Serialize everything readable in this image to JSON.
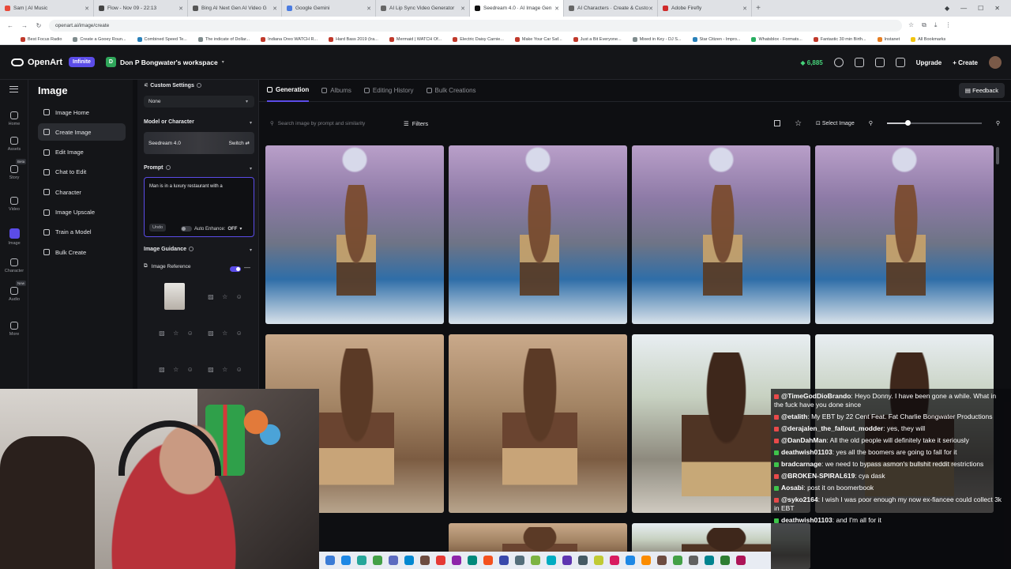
{
  "browser": {
    "tabs": [
      {
        "label": "Sam | AI Music",
        "color": "#e84a3a"
      },
      {
        "label": "Flow - Nov 09 - 22:13",
        "color": "#444444"
      },
      {
        "label": "Bing AI Next Gen AI Video G",
        "color": "#555555"
      },
      {
        "label": "Google Gemini",
        "color": "#4a7be0"
      },
      {
        "label": "AI Lip Sync Video Generator",
        "color": "#666666"
      },
      {
        "label": "Seedream 4.0 · AI Image Gen",
        "color": "#111111"
      },
      {
        "label": "AI Characters · Create & Custo",
        "color": "#666666"
      },
      {
        "label": "Adobe Firefly",
        "color": "#d02a2a"
      }
    ],
    "url": "openart.ai/image/create",
    "bookmarks": [
      {
        "label": "Best Focus Radio",
        "color": "#c0392b"
      },
      {
        "label": "Create a Gooey Roun...",
        "color": "#7f8c8d"
      },
      {
        "label": "Combined Speed Te...",
        "color": "#2980b9"
      },
      {
        "label": "The indicate of Dollar...",
        "color": "#7f8c8d"
      },
      {
        "label": "Indiana Oreo WATCH R...",
        "color": "#c0392b"
      },
      {
        "label": "Hard Bass 2019 (Ira...",
        "color": "#c0392b"
      },
      {
        "label": "Mermaid | WATCH Of...",
        "color": "#c0392b"
      },
      {
        "label": "Electric Daisy Carnie...",
        "color": "#c0392b"
      },
      {
        "label": "Make Your Car Saf...",
        "color": "#c0392b"
      },
      {
        "label": "Just a Bit Everyone...",
        "color": "#c0392b"
      },
      {
        "label": "Mixed in Key - DJ S...",
        "color": "#7f8c8d"
      },
      {
        "label": "Star Citizen - Impro...",
        "color": "#2980b9"
      },
      {
        "label": "Whatsblox - Formats...",
        "color": "#27ae60"
      },
      {
        "label": "Fantastic 30 min Birth...",
        "color": "#c0392b"
      },
      {
        "label": "Instanet",
        "color": "#e67e22"
      },
      {
        "label": "All Bookmarks",
        "color": "#f1c40f"
      }
    ]
  },
  "header": {
    "brand": "OpenArt",
    "plan_badge": "Infinite",
    "workspace_initial": "D",
    "workspace": "Don P Bongwater's workspace",
    "credits": "6,885",
    "upgrade": "Upgrade",
    "create": "Create"
  },
  "rail": [
    {
      "label": "Home"
    },
    {
      "label": "Assets"
    },
    {
      "label": "Story",
      "badge": "Beta"
    },
    {
      "label": "Video"
    },
    {
      "label": "Image"
    },
    {
      "label": "Character"
    },
    {
      "label": "Audio",
      "badge": "New"
    },
    {
      "label": "More"
    }
  ],
  "sidemenu": {
    "title": "Image",
    "items": [
      {
        "label": "Image Home"
      },
      {
        "label": "Create Image"
      },
      {
        "label": "Edit Image"
      },
      {
        "label": "Chat to Edit"
      },
      {
        "label": "Character"
      },
      {
        "label": "Image Upscale"
      },
      {
        "label": "Train a Model"
      },
      {
        "label": "Bulk Create"
      }
    ]
  },
  "settings": {
    "custom_label": "Custom Settings",
    "custom_value": "None",
    "model_label": "Model or Character",
    "model_name": "Seedream 4.0",
    "switch": "Switch",
    "prompt_label": "Prompt",
    "prompt_text": "Man is in a luxury restaurant with a",
    "undo": "Undo",
    "auto_enhance": "Auto Enhance:",
    "auto_enhance_state": "OFF",
    "guidance_label": "Image Guidance",
    "image_reference": "Image Reference"
  },
  "main": {
    "tabs": [
      {
        "label": "Generation"
      },
      {
        "label": "Albums"
      },
      {
        "label": "Editing History"
      },
      {
        "label": "Bulk Creations"
      }
    ],
    "feedback": "Feedback",
    "search_placeholder": "Search image by prompt and similarity",
    "filters": "Filters",
    "select_image": "Select Image",
    "zoom_level": 0.22
  },
  "chat": [
    {
      "user": "@TimeGodDioBrando",
      "text": "Heyo Donny. I have been gone a while. What in the fuck have you done since",
      "color": "#e84a4a"
    },
    {
      "user": "@etalith",
      "text": "My EBT by 22 Cent Feat. Fat Charlie Bongwater Productions",
      "color": "#e84a4a"
    },
    {
      "user": "@derajalen_the_fallout_modder",
      "text": "yes, they will",
      "color": "#e84a4a"
    },
    {
      "user": "@DanDahMan",
      "text": "All the old people will definitely take it seriously",
      "color": "#e84a4a"
    },
    {
      "user": "deathwish01103",
      "text": "yes all the boomers are going to fall for it",
      "color": "#3ec44b"
    },
    {
      "user": "bradcarnage",
      "text": "we need to bypass asmon's bullshit reddit restrictions",
      "color": "#3ec44b"
    },
    {
      "user": "@BROKEN-SPIRAL619",
      "text": "cya dask",
      "color": "#e84a4a"
    },
    {
      "user": "Aosabi",
      "text": "post it on boomerbook",
      "color": "#3ec44b"
    },
    {
      "user": "@syko2164",
      "text": "I wish I was poor enough my now ex-fiancee could collect 3k in EBT",
      "color": "#e84a4a"
    },
    {
      "user": "deathwish01103",
      "text": "and I'm all for it",
      "color": "#3ec44b"
    }
  ],
  "colors": {
    "accent": "#5b4ce8",
    "credits": "#46d37a",
    "bg": "#0e0f12"
  }
}
